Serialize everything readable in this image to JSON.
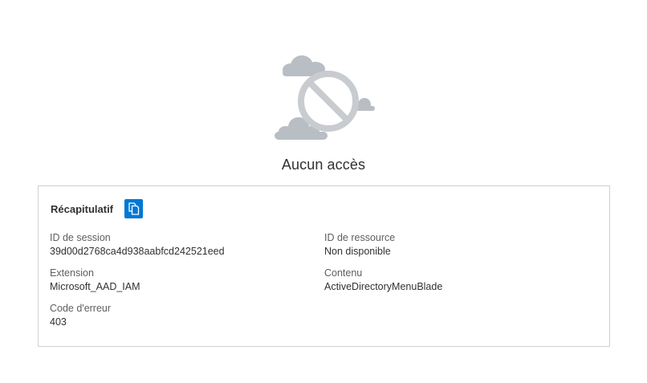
{
  "title": "Aucun accès",
  "summary": {
    "heading": "Récapitulatif",
    "copy_icon": "copy-icon",
    "accent_color": "#0078d4",
    "fields": {
      "session_id": {
        "label": "ID de session",
        "value": "39d00d2768ca4d938aabfcd242521eed"
      },
      "resource_id": {
        "label": "ID de ressource",
        "value": "Non disponible"
      },
      "extension": {
        "label": "Extension",
        "value": "Microsoft_AAD_IAM"
      },
      "content": {
        "label": "Contenu",
        "value": "ActiveDirectoryMenuBlade"
      },
      "error_code": {
        "label": "Code d'erreur",
        "value": "403"
      }
    }
  },
  "illustration_icon": "no-access-cloud-icon"
}
